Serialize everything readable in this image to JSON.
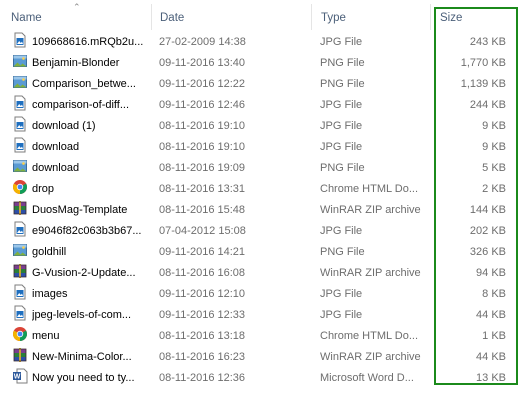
{
  "columns": {
    "name": "Name",
    "date": "Date",
    "type": "Type",
    "size": "Size"
  },
  "files": [
    {
      "name": "109668616.mRQb2u...",
      "date": "27-02-2009 14:38",
      "type": "JPG File",
      "size": "243 KB",
      "icon": "jpg-file-icon"
    },
    {
      "name": "Benjamin-Blonder",
      "date": "09-11-2016 13:40",
      "type": "PNG File",
      "size": "1,770 KB",
      "icon": "png-file-icon"
    },
    {
      "name": "Comparison_betwe...",
      "date": "09-11-2016 12:22",
      "type": "PNG File",
      "size": "1,139 KB",
      "icon": "png-file-icon"
    },
    {
      "name": "comparison-of-diff...",
      "date": "09-11-2016 12:46",
      "type": "JPG File",
      "size": "244 KB",
      "icon": "jpg-file-icon"
    },
    {
      "name": "download (1)",
      "date": "08-11-2016 19:10",
      "type": "JPG File",
      "size": "9 KB",
      "icon": "jpg-file-icon"
    },
    {
      "name": "download",
      "date": "08-11-2016 19:10",
      "type": "JPG File",
      "size": "9 KB",
      "icon": "jpg-file-icon"
    },
    {
      "name": "download",
      "date": "08-11-2016 19:09",
      "type": "PNG File",
      "size": "5 KB",
      "icon": "png-file-icon"
    },
    {
      "name": "drop",
      "date": "08-11-2016 13:31",
      "type": "Chrome HTML Do...",
      "size": "2 KB",
      "icon": "chrome-html-icon"
    },
    {
      "name": "DuosMag-Template",
      "date": "08-11-2016 15:48",
      "type": "WinRAR ZIP archive",
      "size": "144 KB",
      "icon": "winrar-archive-icon"
    },
    {
      "name": "e9046f82c063b3b67...",
      "date": "07-04-2012 15:08",
      "type": "JPG File",
      "size": "202 KB",
      "icon": "jpg-file-icon"
    },
    {
      "name": "goldhill",
      "date": "09-11-2016 14:21",
      "type": "PNG File",
      "size": "326 KB",
      "icon": "png-file-icon"
    },
    {
      "name": "G-Vusion-2-Update...",
      "date": "08-11-2016 16:08",
      "type": "WinRAR ZIP archive",
      "size": "94 KB",
      "icon": "winrar-archive-icon"
    },
    {
      "name": "images",
      "date": "09-11-2016 12:10",
      "type": "JPG File",
      "size": "8 KB",
      "icon": "jpg-file-icon"
    },
    {
      "name": "jpeg-levels-of-com...",
      "date": "09-11-2016 12:33",
      "type": "JPG File",
      "size": "44 KB",
      "icon": "jpg-file-icon"
    },
    {
      "name": "menu",
      "date": "08-11-2016 13:18",
      "type": "Chrome HTML Do...",
      "size": "1 KB",
      "icon": "chrome-html-icon"
    },
    {
      "name": "New-Minima-Color...",
      "date": "08-11-2016 16:23",
      "type": "WinRAR ZIP archive",
      "size": "44 KB",
      "icon": "winrar-archive-icon"
    },
    {
      "name": "Now you need to ty...",
      "date": "08-11-2016 12:36",
      "type": "Microsoft Word D...",
      "size": "13 KB",
      "icon": "word-document-icon"
    }
  ],
  "highlight_color": "#1b8a1b"
}
